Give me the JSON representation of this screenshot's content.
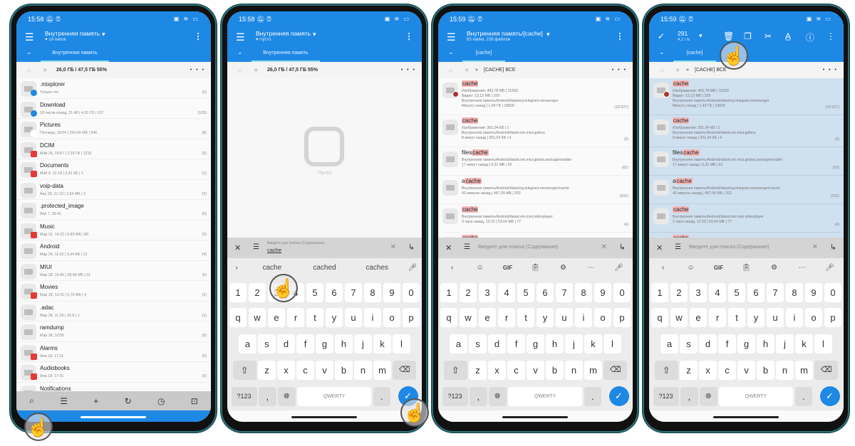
{
  "colors": {
    "accent": "#1e88e5",
    "highlight": "#f4b6b6",
    "selection": "#cfe0ef"
  },
  "common": {
    "title": "Внутренняя память",
    "storage_path": "26,0 ГБ / 47,5 ГБ   55%",
    "search_placeholder": "Введите для поиска (Содержание)",
    "keyboard": {
      "numbers": [
        "1",
        "2",
        "3",
        "4",
        "5",
        "6",
        "7",
        "8",
        "9",
        "0"
      ],
      "row1": [
        "q",
        "w",
        "e",
        "r",
        "t",
        "y",
        "u",
        "i",
        "o",
        "p"
      ],
      "row2": [
        "a",
        "s",
        "d",
        "f",
        "g",
        "h",
        "j",
        "k",
        "l"
      ],
      "row3": [
        "z",
        "x",
        "c",
        "v",
        "b",
        "n",
        "m"
      ],
      "sym": "?123",
      "comma": ",",
      "space": "QWERTY",
      "period": "."
    },
    "kb_toolbar": {
      "gif": "GIF"
    }
  },
  "phone1": {
    "time": "15:58",
    "subtitle": "19 папок",
    "tab": "Внутренняя память",
    "items": [
      {
        "name": ".mixplorer",
        "meta": "Только что",
        "count": "(0)",
        "badge": "blue"
      },
      {
        "name": "Download",
        "meta": "18 часов назад, 21:48 | 4,63 ГБ | 137",
        "count": "(120)",
        "badge": "blue"
      },
      {
        "name": "Pictures",
        "meta": "Пятница, 18:04 | 294,45 МБ | 546",
        "count": "(8)",
        "badge": "white"
      },
      {
        "name": "DCIM",
        "meta": "Май 26, 19:57 | 2,33 ГБ | 1316",
        "count": "(5)",
        "badge": "red"
      },
      {
        "name": "Documents",
        "meta": "Май 9, 12:18 | 3,41  КБ | 1",
        "count": "(1)",
        "badge": "red"
      },
      {
        "name": "voip-data",
        "meta": "Апр 28, 21:10 | 2,84 МБ | 3",
        "count": "(2)",
        "badge": ""
      },
      {
        "name": ".protected_image",
        "meta": "Апр 7, 09:41",
        "count": "(0)",
        "badge": ""
      },
      {
        "name": "Music",
        "meta": "Мар 31, 14:22 | 6,83 МБ | 80",
        "count": "(3)",
        "badge": "red"
      },
      {
        "name": "Android",
        "meta": "Мар 29, 11:02 | 3,44  КБ | 12",
        "count": "(4)",
        "badge": ""
      },
      {
        "name": "MIUI",
        "meta": "Мар 28, 16:45 | 28,98 МБ | 31",
        "count": "(5)",
        "badge": ""
      },
      {
        "name": "Movies",
        "meta": "Мар 28, 13:25 | 5,70 МБ | 4",
        "count": "(2)",
        "badge": "red"
      },
      {
        "name": ".adac",
        "meta": "Мар 28, 11:29 | 16 Б | 1",
        "count": "(1)",
        "badge": ""
      },
      {
        "name": "ramdump",
        "meta": "Мар 28, 10:50",
        "count": "(0)",
        "badge": ""
      },
      {
        "name": "Alarms",
        "meta": "Фев 18, 17:31",
        "count": "(0)",
        "badge": "red"
      },
      {
        "name": "Audiobooks",
        "meta": "Фев 18, 17:31",
        "count": "(0)",
        "badge": "red"
      },
      {
        "name": "Notifications",
        "meta": "",
        "count": "",
        "badge": ""
      }
    ],
    "toolbar": [
      "search-icon",
      "list-icon",
      "plus-icon",
      "refresh-icon",
      "history-icon",
      "select-icon"
    ]
  },
  "phone2": {
    "time": "15:58",
    "subtitle": "Пусто",
    "tab": "Внутренняя память",
    "empty_label": "Пусто",
    "search_value": "cache",
    "suggestions": [
      "cache",
      "cached",
      "caches"
    ]
  },
  "phone3": {
    "time": "15:59",
    "title": "Внутренняя память/[cache]",
    "subtitle": "63 папки, 228 файлов",
    "tab": "[cache]",
    "path": "[CACHE] ВСЕ"
  },
  "phone4": {
    "time": "15:59",
    "selected_count": "291",
    "selected_size": "4,1 ГБ",
    "tab": "[cache]",
    "path": "[CACHE] ВСЕ"
  },
  "results": [
    {
      "prefix": "",
      "match": "cache",
      "lines": [
        "Изображения: 493,78 МБ | 11559",
        "Видео: 13,13 МБ | 159",
        "Внутренняя память/Android/data/org.telegram.messenger",
        "Минуту назад | 1,49 ГБ | 18829"
      ],
      "count": "(18 627)"
    },
    {
      "prefix": "",
      "match": "cache",
      "lines": [
        "Изображения: 301,04  КБ | 1",
        "Внутренняя память/Android/data/com.miui.gallery",
        "8 минут назад | 301,04  КБ | 4"
      ],
      "count": "(3)"
    },
    {
      "prefix": "files",
      "match": "cache",
      "lines": [
        "Внутренняя память/Android/data/com.miui.global.packageinstaller",
        "17 минут назад | 9,31 МБ | 62"
      ],
      "count": "(62)"
    },
    {
      "prefix": "a",
      "match": "cache",
      "lines": [
        "Внутренняя память/Android/data/org.telegram.messenger/cache",
        "42 минуты назад | 467,09 МБ | 202"
      ],
      "count": "(202)"
    },
    {
      "prefix": "",
      "match": "cache",
      "lines": [
        "Внутренняя память/Android/data/com.miui.videoplayer",
        "3 часа назад, 12:22 | 53,64 МБ | 77"
      ],
      "count": "(4)"
    },
    {
      "prefix": "",
      "match": "cache",
      "lines": [],
      "count": ""
    }
  ]
}
